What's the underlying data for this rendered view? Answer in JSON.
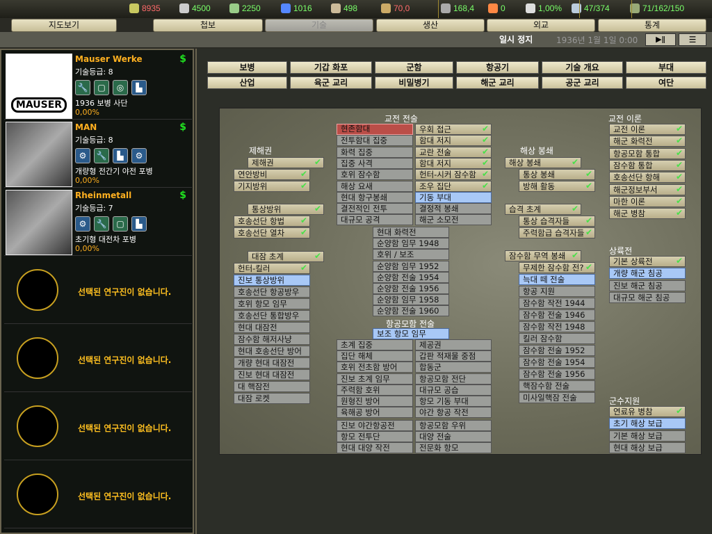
{
  "resources": [
    {
      "icon": "energy-icon",
      "value": "8935",
      "color": "red"
    },
    {
      "icon": "metal-icon",
      "value": "4500",
      "color": "grn"
    },
    {
      "icon": "rare-materials-icon",
      "value": "2250",
      "color": "grn"
    },
    {
      "icon": "oil-icon",
      "value": "1016",
      "color": "grn"
    },
    {
      "icon": "supplies-icon",
      "value": "498",
      "color": "grn"
    },
    {
      "icon": "money-icon",
      "value": "70,0",
      "color": "red"
    },
    {
      "icon": "manpower-icon",
      "value": "168,4",
      "color": "grn"
    },
    {
      "icon": "nuke-icon",
      "value": "0",
      "color": "grn"
    },
    {
      "icon": "dissent-icon",
      "value": "1,00%",
      "color": "grn"
    },
    {
      "icon": "transport-icon",
      "value": "47/374",
      "color": "grn"
    },
    {
      "icon": "ic-icon",
      "value": "71/162/150",
      "color": "grn"
    }
  ],
  "tabs": [
    "지도보기",
    "첩보",
    "기술",
    "생산",
    "외교",
    "통계"
  ],
  "status": {
    "paused": "일시 정지",
    "date": "1936년 1월 1일 0:00",
    "play": "▶ǁ",
    "menu": "☰"
  },
  "teams": [
    {
      "name": "Mauser Werke",
      "level": "기술등급: 8",
      "icons": [
        "🔧",
        "▢",
        "◎",
        "▙"
      ],
      "project": "1936 보병 사단",
      "progress": "0,00%",
      "logo": "MAUSER"
    },
    {
      "name": "MAN",
      "level": "기술등급: 8",
      "icons": [
        "⚙",
        "🔧",
        "▙",
        "⚙"
      ],
      "project": "개량형 전간기 야전 포병",
      "progress": "0,00%"
    },
    {
      "name": "Rheinmetall",
      "level": "기술등급: 7",
      "icons": [
        "⚙",
        "🔧",
        "▢",
        "▙"
      ],
      "project": "초기형 대전차 포병",
      "progress": "0,00%"
    }
  ],
  "empty_slot": "선택된 연구진이 없습니다.",
  "categories": [
    "보병",
    "기갑 화포",
    "군함",
    "항공기",
    "기술 개요",
    "부대",
    "산업",
    "육군 교리",
    "비밀병기",
    "해군 교리",
    "공군 교리",
    "여단"
  ],
  "tech_groups": [
    {
      "title": "제해권",
      "items": [
        [
          "제해권",
          "done",
          1
        ],
        [
          "연안방비",
          "done",
          0
        ],
        [
          "기지방위",
          "done",
          0
        ]
      ]
    },
    {
      "title": "",
      "items": [
        [
          "통상방위",
          "done",
          1
        ],
        [
          "호송선단 항법",
          "done",
          0
        ],
        [
          "호송선단 열차",
          "done",
          0
        ]
      ]
    },
    {
      "title": "",
      "items": [
        [
          "대잠 초계",
          "done",
          1
        ],
        [
          "헌터-킬러",
          "done",
          0
        ],
        [
          "진보 통상방위",
          "av",
          0
        ],
        [
          "호송선단 항공방우",
          "na",
          0
        ],
        [
          "호위 항모 임무",
          "na",
          0
        ],
        [
          "호송선단 통합방우",
          "na",
          0
        ],
        [
          "현대 대잠전",
          "na",
          0
        ],
        [
          "잠수함 해저사냥",
          "na",
          0
        ],
        [
          "현대 호송선단 방어",
          "na",
          0
        ],
        [
          "개량 현대 대잠전",
          "na",
          0
        ],
        [
          "진보 현대 대잠전",
          "na",
          0
        ],
        [
          "대 핵잠전",
          "na",
          0
        ],
        [
          "대잠 로켓",
          "na",
          0
        ]
      ]
    },
    {
      "title": "교전 전술",
      "items": [
        [
          "현존함대",
          "res",
          0
        ],
        [
          "전투함대 집중",
          "na",
          0
        ],
        [
          "화력 집중",
          "na",
          0
        ],
        [
          "집중 사격",
          "na",
          0
        ],
        [
          "호위 잠수함",
          "na",
          0
        ],
        [
          "해상 요새",
          "na",
          0
        ],
        [
          "현대 항구봉쇄",
          "na",
          0
        ],
        [
          "결전적인 전투",
          "na",
          0
        ],
        [
          "대규모 공격",
          "na",
          0
        ]
      ]
    },
    {
      "title": "",
      "items": [
        [
          "우회 접근",
          "done",
          0
        ],
        [
          "함대 저지",
          "done",
          0
        ],
        [
          "교란 전술",
          "done",
          0
        ],
        [
          "함대 저지",
          "done",
          0
        ],
        [
          "헌터-시커 잠수함",
          "done",
          0
        ],
        [
          "조우 집단",
          "done",
          0
        ],
        [
          "기동 부대",
          "av",
          0
        ],
        [
          "결정적 봉쇄",
          "na",
          0
        ],
        [
          "해군 소모전",
          "na",
          0
        ]
      ]
    },
    {
      "title": "",
      "items": [
        [
          "현대 화력전",
          "na",
          0
        ],
        [
          "순양함 임무 1948",
          "na",
          0
        ],
        [
          "호위 / 보조",
          "na",
          0
        ],
        [
          "순양함 임무 1952",
          "na",
          0
        ],
        [
          "순양함 전술 1954",
          "na",
          0
        ],
        [
          "순양함 전술 1956",
          "na",
          0
        ],
        [
          "순양함 임무 1958",
          "na",
          0
        ],
        [
          "순양함 전술 1960",
          "na",
          0
        ]
      ]
    },
    {
      "title": "항공모함 전술",
      "items": [
        [
          "보조 항모 임무",
          "av",
          0
        ]
      ]
    },
    {
      "title": "",
      "items": [
        [
          "초계 집중",
          "na",
          0
        ],
        [
          "집단 해체",
          "na",
          0
        ],
        [
          "호위 전초함 방어",
          "na",
          0
        ],
        [
          "진보 초계 임무",
          "na",
          0
        ],
        [
          "주력함 호위",
          "na",
          0
        ],
        [
          "원형진 방어",
          "na",
          0
        ],
        [
          "육해공 방어",
          "na",
          0
        ]
      ]
    },
    {
      "title": "",
      "items": [
        [
          "제공권",
          "na",
          0
        ],
        [
          "갑판 적재물 중점",
          "na",
          0
        ],
        [
          "합동군",
          "na",
          0
        ],
        [
          "항공모함 전단",
          "na",
          0
        ],
        [
          "대규모 공습",
          "na",
          0
        ],
        [
          "항모 기동 부대",
          "na",
          0
        ],
        [
          "야간 항공 작전",
          "na",
          0
        ]
      ]
    },
    {
      "title": "",
      "items": [
        [
          "진보 야간항공전",
          "na",
          0
        ],
        [
          "항모 전투단",
          "na",
          0
        ],
        [
          "현대 대양 작전",
          "na",
          0
        ]
      ]
    },
    {
      "title": "",
      "items": [
        [
          "항공모함 우위",
          "na",
          0
        ],
        [
          "대양 전술",
          "na",
          0
        ],
        [
          "전문화 항모",
          "na",
          0
        ]
      ]
    },
    {
      "title": "해상 봉쇄",
      "items": [
        [
          "해상 봉쇄",
          "done",
          0
        ],
        [
          "통상 봉쇄",
          "done",
          1
        ],
        [
          "방해 활동",
          "done",
          1
        ]
      ]
    },
    {
      "title": "",
      "items": [
        [
          "습격 초계",
          "done",
          0
        ],
        [
          "통상 습격자들",
          "done",
          1
        ],
        [
          "주력함급 습격자들",
          "done",
          1
        ]
      ]
    },
    {
      "title": "",
      "items": [
        [
          "잠수함 무역 봉쇄",
          "done",
          0
        ],
        [
          "무제한 잠수함 전?",
          "done",
          1
        ],
        [
          "늑대 떼 전술",
          "av",
          1
        ],
        [
          "항공 지원",
          "na",
          1
        ],
        [
          "잠수함 작전 1944",
          "na",
          1
        ],
        [
          "잠수함 전술 1946",
          "na",
          1
        ],
        [
          "잠수함 작전 1948",
          "na",
          1
        ],
        [
          "킬러 잠수함",
          "na",
          1
        ],
        [
          "잠수함 전술 1952",
          "na",
          1
        ],
        [
          "잠수함 전술 1954",
          "na",
          1
        ],
        [
          "잠수함 전술 1956",
          "na",
          1
        ],
        [
          "핵잠수함 전술",
          "na",
          1
        ],
        [
          "미사일핵잠 전술",
          "na",
          1
        ]
      ]
    },
    {
      "title": "교전 이론",
      "items": [
        [
          "교전 이론",
          "done",
          0
        ],
        [
          "해군 화력전",
          "done",
          0
        ],
        [
          "항공모함 통합",
          "done",
          0
        ],
        [
          "잠수함 통합",
          "done",
          0
        ],
        [
          "호송선단 항해",
          "done",
          0
        ],
        [
          "해군정보부서",
          "done",
          0
        ],
        [
          "마한 이론",
          "done",
          0
        ],
        [
          "해군 병참",
          "done",
          0
        ]
      ]
    },
    {
      "title": "상륙전",
      "items": [
        [
          "기본 상륙전",
          "done",
          0
        ],
        [
          "개량 해군 침공",
          "av",
          0
        ],
        [
          "진보 해군 침공",
          "na",
          0
        ],
        [
          "대규모 해군 침공",
          "na",
          0
        ]
      ]
    },
    {
      "title": "군수지원",
      "items": [
        [
          "연료유 병참",
          "done",
          0
        ],
        [
          "초기 해상 보급",
          "av",
          0
        ],
        [
          "기본 해상 보급",
          "na",
          0
        ],
        [
          "현대 해상 보급",
          "na",
          0
        ]
      ]
    }
  ],
  "colors": {
    "done": "#c8bfa0",
    "researching": "#bb4e48",
    "available": "#a8c8f6",
    "unavailable": "#9c9e9a"
  }
}
